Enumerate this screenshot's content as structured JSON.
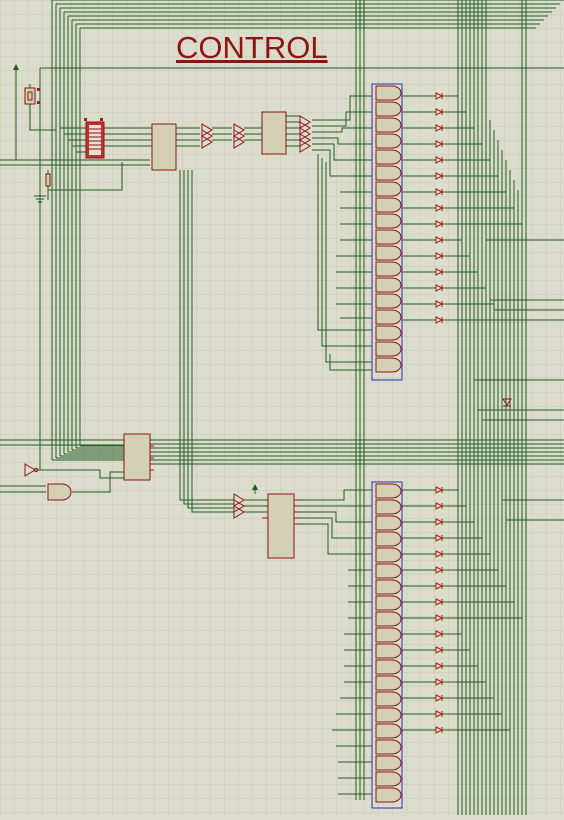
{
  "title": "CONTROL",
  "colors": {
    "background": "#dcdccc",
    "grid": "#c9c9b8",
    "wire": "#1f5c1f",
    "component_stroke": "#8b1414",
    "component_fill": "#d4d0b4",
    "pin": "#b31818",
    "bus_outline": "#2b2bb5"
  },
  "icons": [
    "ground-icon",
    "power-terminal-icon",
    "diode-icon",
    "buffer-icon",
    "and-gate-icon",
    "dip-switch-icon"
  ]
}
